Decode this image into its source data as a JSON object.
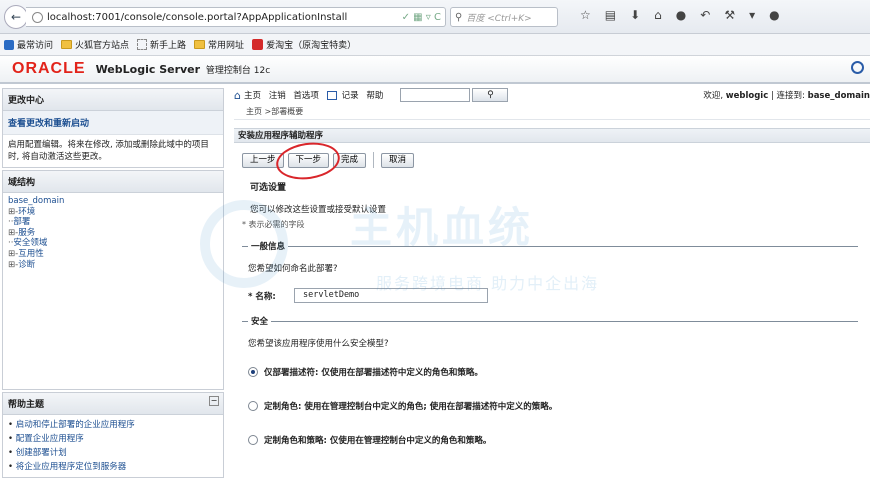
{
  "browser": {
    "url": "localhost:7001/console/console.portal?AppApplicationInstall",
    "search_placeholder": "百度 <Ctrl+K>"
  },
  "bookmarks": [
    {
      "label": "最常访问",
      "icon": "star-page-icon"
    },
    {
      "label": "火狐官方站点",
      "icon": "folder-icon"
    },
    {
      "label": "新手上路",
      "icon": "page-icon"
    },
    {
      "label": "常用网址",
      "icon": "folder-icon"
    },
    {
      "label": "爱淘宝（原淘宝特卖）",
      "icon": "taobao-icon"
    }
  ],
  "header": {
    "logo": "ORACLE",
    "product": "WebLogic Server",
    "sub": "管理控制台 12c"
  },
  "change_center": {
    "title": "更改中心",
    "link": "查看更改和重新启动",
    "body": "启用配置编辑。将来在修改, 添加或删除此域中的项目时, 将自动激活这些更改。"
  },
  "domain_structure": {
    "title": "域结构",
    "root": "base_domain",
    "nodes": [
      {
        "prefix": "⊞-",
        "label": "环境"
      },
      {
        "prefix": "··",
        "label": "部署"
      },
      {
        "prefix": "⊞-",
        "label": "服务"
      },
      {
        "prefix": "··",
        "label": "安全领域"
      },
      {
        "prefix": "⊞-",
        "label": "互用性"
      },
      {
        "prefix": "⊞-",
        "label": "诊断"
      }
    ]
  },
  "help": {
    "title": "帮助主题",
    "items": [
      "启动和停止部署的企业应用程序",
      "配置企业应用程序",
      "创建部署计划",
      "将企业应用程序定位到服务器"
    ]
  },
  "topbar": {
    "home": "主页",
    "logout": "注销",
    "prefs": "首选项",
    "record": "记录",
    "help": "帮助",
    "welcome_prefix": "欢迎,",
    "user": "weblogic",
    "connected_prefix": "连接到:",
    "domain": "base_domain"
  },
  "breadcrumb": "主页 >部署概要",
  "content": {
    "title": "安装应用程序辅助程序",
    "buttons": {
      "back": "上一步",
      "next": "下一步",
      "finish": "完成",
      "cancel": "取消"
    },
    "optional_title": "可选设置",
    "optional_desc": "您可以修改这些设置或接受默认设置",
    "required_note": "* 表示必需的字段",
    "general_section": "一般信息",
    "name_question": "您希望如何命名此部署?",
    "name_label": "名称:",
    "name_value": "servletDemo",
    "security_section": "安全",
    "security_question": "您希望该应用程序使用什么安全模型?",
    "options": [
      {
        "label": "仅部署描述符: 仅使用在部署描述符中定义的角色和策略。",
        "selected": true
      },
      {
        "label": "定制角色: 使用在管理控制台中定义的角色; 使用在部署描述符中定义的策略。",
        "selected": false
      },
      {
        "label": "定制角色和策略: 仅使用在管理控制台中定义的角色和策略。",
        "selected": false
      }
    ]
  },
  "watermark": {
    "big": "主机血统",
    "small": "服务跨境电商 助力中企出海"
  }
}
